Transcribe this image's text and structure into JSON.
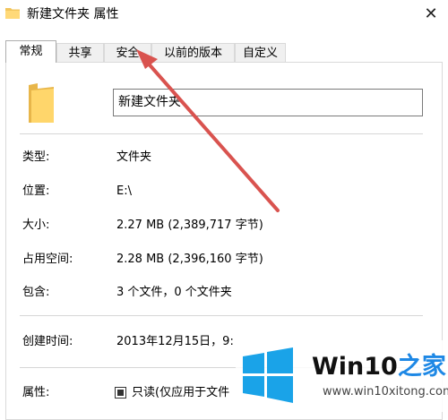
{
  "window": {
    "title": "新建文件夹 属性",
    "close_symbol": "✕"
  },
  "tabs": [
    {
      "label": "常规",
      "active": true
    },
    {
      "label": "共享",
      "active": false
    },
    {
      "label": "安全",
      "active": false
    },
    {
      "label": "以前的版本",
      "active": false
    },
    {
      "label": "自定义",
      "active": false
    }
  ],
  "general": {
    "folder_name": "新建文件夹",
    "rows": {
      "type": {
        "label": "类型:",
        "value": "文件夹"
      },
      "location": {
        "label": "位置:",
        "value": "E:\\"
      },
      "size": {
        "label": "大小:",
        "value": "2.27 MB (2,389,717 字节)"
      },
      "size_on_disk": {
        "label": "占用空间:",
        "value": "2.28 MB (2,396,160 字节)"
      },
      "contains": {
        "label": "包含:",
        "value": "3 个文件，0 个文件夹"
      },
      "created": {
        "label": "创建时间:",
        "value": "2013年12月15日，9:"
      },
      "attributes": {
        "label": "属性:",
        "value": "只读(仅应用于文件"
      }
    }
  },
  "annotation": {
    "arrow_color": "#d9534f"
  },
  "watermark": {
    "title_main": "Win10",
    "title_accent": "之家",
    "url": "www.win10xitong.com",
    "colors": {
      "logo": "#1aa3e8",
      "accent": "#1e88e5"
    }
  },
  "icons": {
    "title": "folder-icon",
    "big": "folder-icon",
    "close": "close-icon",
    "logo": "windows-logo-icon"
  }
}
